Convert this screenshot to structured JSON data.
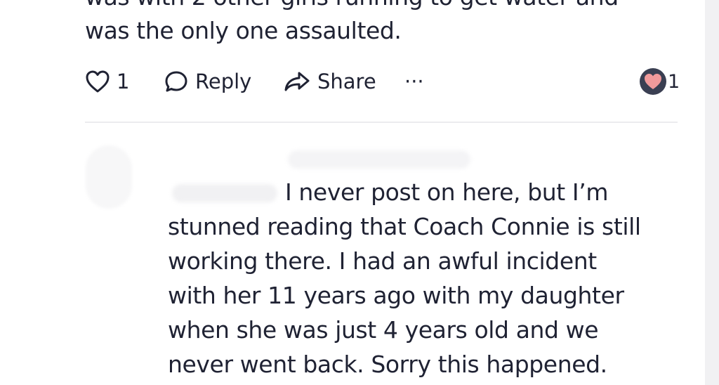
{
  "comment": {
    "text": "was with 2 other girls running to get water and\nwas the only one assaulted."
  },
  "actions": {
    "like_count": "1",
    "reply_label": "Reply",
    "share_label": "Share",
    "more_label": "···",
    "reaction_count": "1"
  },
  "icons": {
    "like": "heart-outline-icon",
    "reply": "speech-bubble-icon",
    "share": "share-arrow-icon",
    "reaction": "heart-reaction-icon"
  },
  "colors": {
    "text": "#1f2233",
    "reaction_heart": "#f19a9b",
    "reaction_bubble": "#3a3f52"
  },
  "reply_comment": {
    "first_line": "I never post on here, but I’m",
    "rest": "stunned reading that Coach Connie is still\nworking there. I had an awful incident\nwith her 11 years ago with my daughter\nwhen she was just 4 years old and we\nnever went back. Sorry this happened."
  }
}
